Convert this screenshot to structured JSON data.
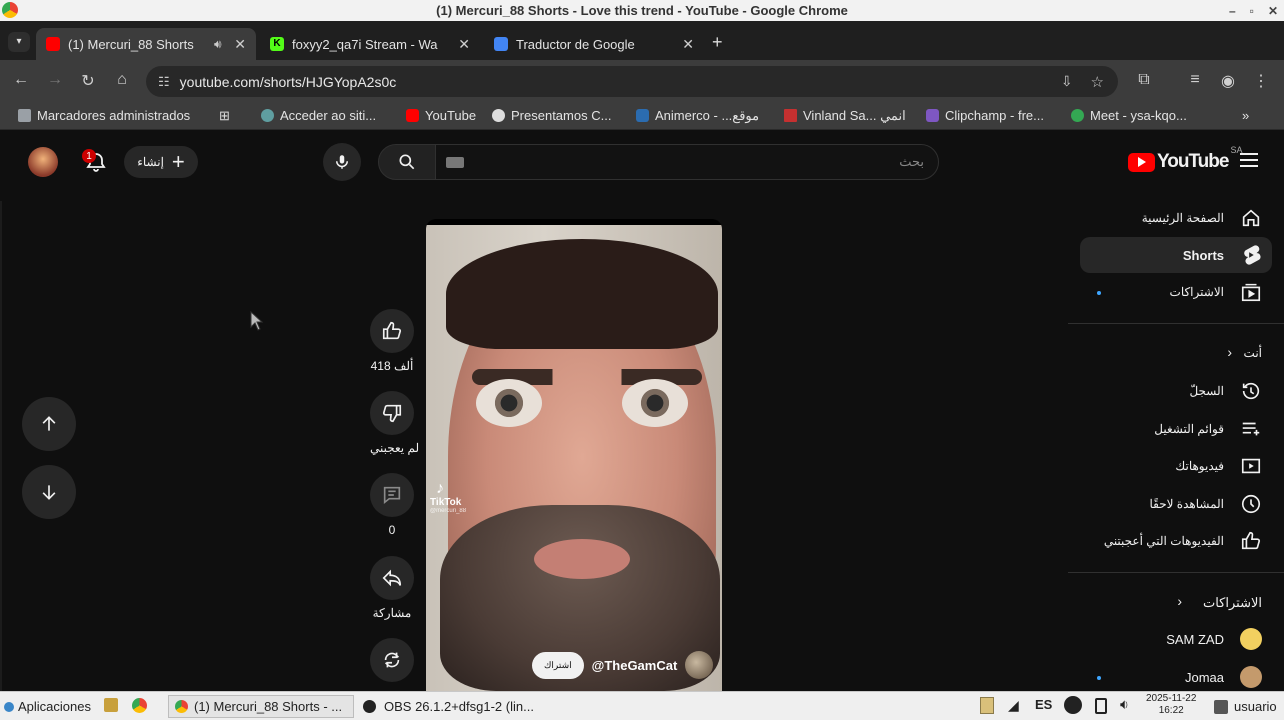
{
  "window": {
    "title": "(1) Mercuri_88 Shorts - Love this trend - YouTube - Google Chrome",
    "controls": [
      "–",
      "▫",
      "✕"
    ]
  },
  "tabs": [
    {
      "label": "(1) Mercuri_88 Shorts",
      "icon": "youtube-icon",
      "color": "#ff0000",
      "active": true
    },
    {
      "label": "foxyy2_qa7i Stream - Wa",
      "icon": "kick-icon",
      "color": "#53fc18",
      "active": false
    },
    {
      "label": "Traductor de Google",
      "icon": "translate-icon",
      "color": "#4285f4",
      "active": false
    }
  ],
  "address": {
    "url": "youtube.com/shorts/HJGYopA2s0c"
  },
  "bookmarks": [
    {
      "label": "Marcadores administrados",
      "color": "#9aa0a6"
    },
    {
      "label": "Acceder ao siti...",
      "color": "#5f9ea0"
    },
    {
      "label": "YouTube",
      "color": "#ff0000"
    },
    {
      "label": "Presentamos C...",
      "color": "#dddddd"
    },
    {
      "label": "Animerco - ...موقع",
      "color": "#2b6cb0"
    },
    {
      "label": "Vinland Sa... انمي",
      "color": "#c53030"
    },
    {
      "label": "Clipchamp - fre...",
      "color": "#7e57c2"
    },
    {
      "label": "Meet - ysa-kqo...",
      "color": "#34a853"
    }
  ],
  "yt": {
    "create_label": "إنشاء",
    "notif_count": "1",
    "search_placeholder": "بحث",
    "logo_text": "YouTube",
    "region": "SA",
    "sidebar": {
      "home": "الصفحة الرئيسية",
      "shorts": "Shorts",
      "subs": "الاشتراكات",
      "you": "أنت",
      "history": "السجلّ",
      "playlists": "قوائم التشغيل",
      "your_videos": "فيديوهاتك",
      "watch_later": "المشاهدة لاحقًا",
      "liked": "الفيديوهات التي أعجبتني",
      "subs_header": "الاشتراكات",
      "channels": [
        {
          "name": "SAM ZAD",
          "color": "#f2d060"
        },
        {
          "name": "Jomaa",
          "color": "#c49a6c"
        }
      ]
    },
    "actions": {
      "likes": "418 ألف",
      "dislike": "لم يعجبني",
      "comments": "0",
      "share": "مشاركة"
    },
    "video": {
      "watermark": "TikTok",
      "watermark_user": "@mercuri_88",
      "channel": "@TheGamCat",
      "subscribe": "اشتراك"
    }
  },
  "taskbar": {
    "apps_label": "Aplicaciones",
    "tasks": [
      "(1) Mercuri_88 Shorts - ...",
      "OBS 26.1.2+dfsg1-2 (lin..."
    ],
    "lang": "ES",
    "date": "2025-11-22",
    "time": "16:22",
    "user": "usuario"
  }
}
